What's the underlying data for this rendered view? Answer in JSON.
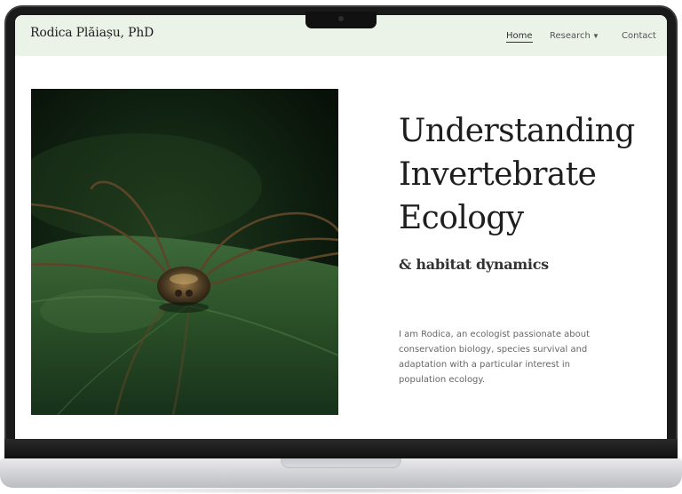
{
  "site": {
    "brand": "Rodica Plăiașu, PhD",
    "nav": {
      "home": "Home",
      "research": "Research",
      "contact": "Contact"
    }
  },
  "hero": {
    "headline_lines": [
      "Understanding",
      "Invertebrate",
      "Ecology"
    ],
    "subheadline": "& habitat dynamics",
    "bio": "I am Rodica, an ecologist passionate about conservation biology, species survival and adaptation with a particular interest in population ecology.",
    "image_subject": "harvestman spider on a green leaf"
  },
  "colors": {
    "nav_background": "#ebf3e8",
    "text_dark": "#1e1e1e",
    "text_muted": "#666666"
  },
  "icons": {
    "research_dropdown": "chevron-down-icon"
  }
}
